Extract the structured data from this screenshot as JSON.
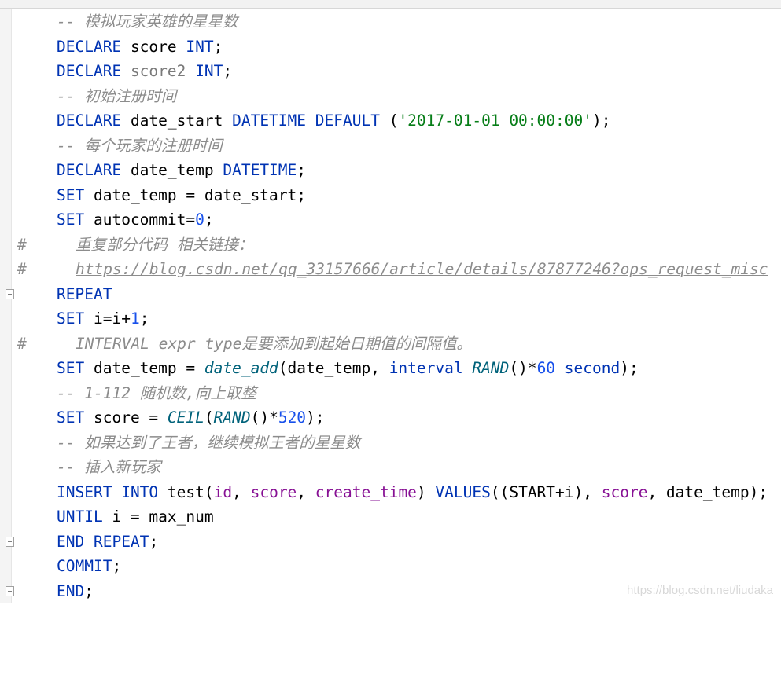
{
  "colors": {
    "keyword": "#0033b3",
    "number": "#1750eb",
    "string": "#067d17",
    "comment": "#8c8c8c",
    "function": "#00627a",
    "column": "#871094",
    "background": "#ffffff",
    "gutter": "#f4f4f4"
  },
  "icons": {
    "fold": "fold-marker-icon"
  },
  "lines": [
    {
      "c": "模拟玩家英雄的星星数"
    },
    {
      "name": "score"
    },
    {
      "name": "score2"
    },
    {
      "c": "初始注册时间"
    },
    {
      "a": "DECLARE",
      "b": "date_start",
      "c": "DATETIME",
      "d": "DEFAULT",
      "e": "'2017-01-01 00:00:00'"
    },
    {
      "c": "每个玩家的注册时间"
    },
    {
      "a": "DECLARE",
      "b": "date_temp",
      "c": "DATETIME"
    },
    {
      "a": "SET",
      "b": "date_temp = date_start;"
    },
    {
      "a": "SET",
      "b": "autocommit=",
      "n": "0"
    },
    {
      "hash": "#",
      "c": "重复部分代码 相关链接："
    },
    {
      "hash": "#",
      "url": "https://blog.csdn.net/qq_33157666/article/details/87877246?ops_request_misc"
    },
    {
      "a": "REPEAT"
    },
    {
      "a": "SET",
      "b": "i=i+",
      "n": "1"
    },
    {
      "hash": "#",
      "c": "INTERVAL expr type是要添加到起始日期值的间隔值。"
    },
    {
      "a": "SET",
      "b": "date_temp = ",
      "f": "date_add",
      "g": "(date_temp, ",
      "k": "interval",
      "f2": "RAND",
      "g2": "()*",
      "n": "60",
      "k2": "second",
      "g3": ");"
    },
    {
      "c": "1-112 随机数,向上取整"
    },
    {
      "a": "SET",
      "b": "score = ",
      "f": "CEIL",
      "f2": "RAND",
      "g": "()*",
      "n": "520",
      "g2": ");"
    },
    {
      "c": "如果达到了王者，继续模拟王者的星星数"
    },
    {
      "c": "插入新玩家"
    },
    {
      "a": "INSERT",
      "a2": "INTO",
      "b": "test(",
      "c1": "id",
      "c2": "score",
      "c3": "create_time",
      "k": "VALUES",
      "b2": "((START+i), ",
      "c4": "score",
      "b3": ", date_temp);"
    },
    {
      "a": "UNTIL",
      "b": " i = max_num"
    },
    {
      "a": "END",
      "a2": "REPEAT"
    },
    {
      "a": "COMMIT"
    },
    {
      "a": "END"
    }
  ],
  "kw": {
    "declare": "DECLARE",
    "int": "INT"
  },
  "comment_prefix": "-- ",
  "watermark": "https://blog.csdn.net/liudaka"
}
